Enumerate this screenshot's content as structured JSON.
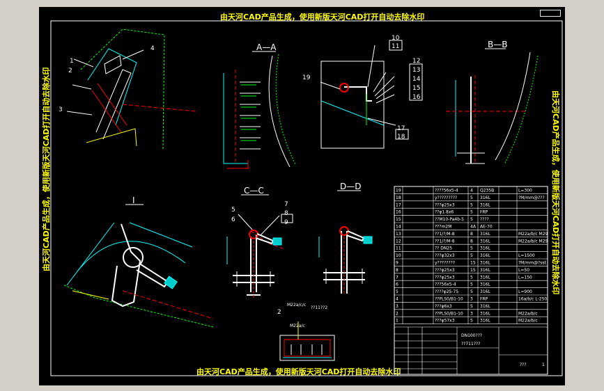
{
  "watermark_top": "由天河CAD产品生成，使用新版天河CAD打开自动去除水印",
  "watermark_bottom": "由天河CAD产品生成，使用新版天河CAD打开自动去除水印",
  "watermark_left": "由天河CAD产品生成，使用新版天河CAD打开自动去除水印",
  "watermark_right": "由天河CAD产品生成，使用新版天河CAD打开自动去除水印",
  "sections": {
    "aa": "A—A",
    "bb": "B—B",
    "cc": "C—C",
    "dd": "D—D",
    "detail": "I"
  },
  "callouts": {
    "c1": "1",
    "c2": "2",
    "c3": "3",
    "c4": "4",
    "c5": "5",
    "c6": "6",
    "c7": "7",
    "c8": "8",
    "c9": "9",
    "c10": "10",
    "c11": "11",
    "c12": "12",
    "c13": "13",
    "c14": "14",
    "c15": "15",
    "c16": "16",
    "c17": "17",
    "c18": "18",
    "c19": "19",
    "c2b": "2"
  },
  "note_top": "M22a/c/c",
  "note_top2": "??11??2",
  "note_mid": "M22a/c",
  "bom": [
    {
      "no": "19",
      "code": "????56x5-4",
      "qty": "4",
      "mat": "Q235B",
      "note": "L=300"
    },
    {
      "no": "18",
      "code": "y?????????",
      "qty": "5",
      "mat": "316L",
      "note": "?M/mm@???"
    },
    {
      "no": "17",
      "code": "???φ25x3",
      "qty": "5",
      "mat": "316L",
      "note": ""
    },
    {
      "no": "16",
      "code": "??φ1.8x6",
      "qty": "5",
      "mat": "FRP",
      "note": ""
    },
    {
      "no": "15",
      "code": "??M10-Pa4b-5",
      "qty": "5",
      "mat": "????",
      "note": ""
    },
    {
      "no": "14",
      "code": "???m2M",
      "qty": "4A",
      "mat": "AE-70",
      "note": ""
    },
    {
      "no": "13",
      "code": "??1/?/M-8",
      "qty": "8",
      "mat": "316L",
      "note": "M22a/b/c M29"
    },
    {
      "no": "12",
      "code": "??1/?/M-8",
      "qty": "8",
      "mat": "316L",
      "note": "M22a/b/c M29"
    },
    {
      "no": "11",
      "code": "?? DN25",
      "qty": "5",
      "mat": "316L",
      "note": ""
    },
    {
      "no": "10",
      "code": "???φ32x3",
      "qty": "5",
      "mat": "316L",
      "note": "L=1500"
    },
    {
      "no": "9",
      "code": "y????????",
      "qty": "15",
      "mat": "316L",
      "note": "?M/mm@?sst"
    },
    {
      "no": "8",
      "code": "???φ25x3",
      "qty": "15",
      "mat": "316L",
      "note": "L=50"
    },
    {
      "no": "7",
      "code": "???φ25x3",
      "qty": "5",
      "mat": "316L",
      "note": "L=150"
    },
    {
      "no": "6",
      "code": "???56x5-4",
      "qty": "5",
      "mat": "316L",
      "note": ""
    },
    {
      "no": "5",
      "code": "????φ25-75",
      "qty": "5",
      "mat": "316L",
      "note": "L=900"
    },
    {
      "no": "4",
      "code": "??PLS0/B1-10",
      "qty": "3",
      "mat": "FRP",
      "note": "16a/b/c L-250"
    },
    {
      "no": "3",
      "code": "???φ6x3",
      "qty": "5",
      "mat": "316L",
      "note": ""
    },
    {
      "no": "2",
      "code": "??PLS0/B1-10",
      "qty": "3",
      "mat": "316L",
      "note": "M22a/b/c"
    },
    {
      "no": "1",
      "code": "???φ57x3",
      "qty": "5",
      "mat": "316L",
      "note": "M22a/b/c"
    }
  ],
  "title_block": {
    "drawing_no": "DN100???",
    "sub": "??711???",
    "scale": "???",
    "sheet": "1"
  }
}
